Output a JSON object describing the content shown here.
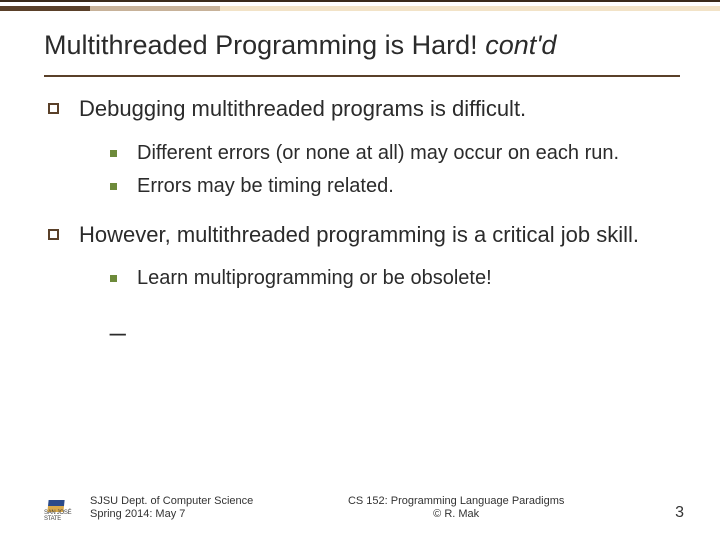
{
  "topbar": {
    "c1": "#5a4029",
    "c2": "#c7b299",
    "c3": "#f2e3c7"
  },
  "title": {
    "main": "Multithreaded Programming is Hard! ",
    "suffix": "cont'd"
  },
  "points": [
    {
      "text": "Debugging multithreaded programs is difficult.",
      "sub": [
        "Different errors (or none at all) may occur on each run.",
        "Errors may be timing related."
      ]
    },
    {
      "text": "However, multithreaded programming is a critical job skill.",
      "sub": [
        "Learn multiprogramming or be obsolete!"
      ],
      "trailing_dash": "_"
    }
  ],
  "footer": {
    "left_line1": "SJSU Dept. of Computer Science",
    "left_line2": "Spring 2014: May 7",
    "center_line1": "CS 152: Programming Language Paradigms",
    "center_line2": "© R. Mak",
    "page": "3",
    "logo_caption": "SAN JOSÉ STATE"
  }
}
